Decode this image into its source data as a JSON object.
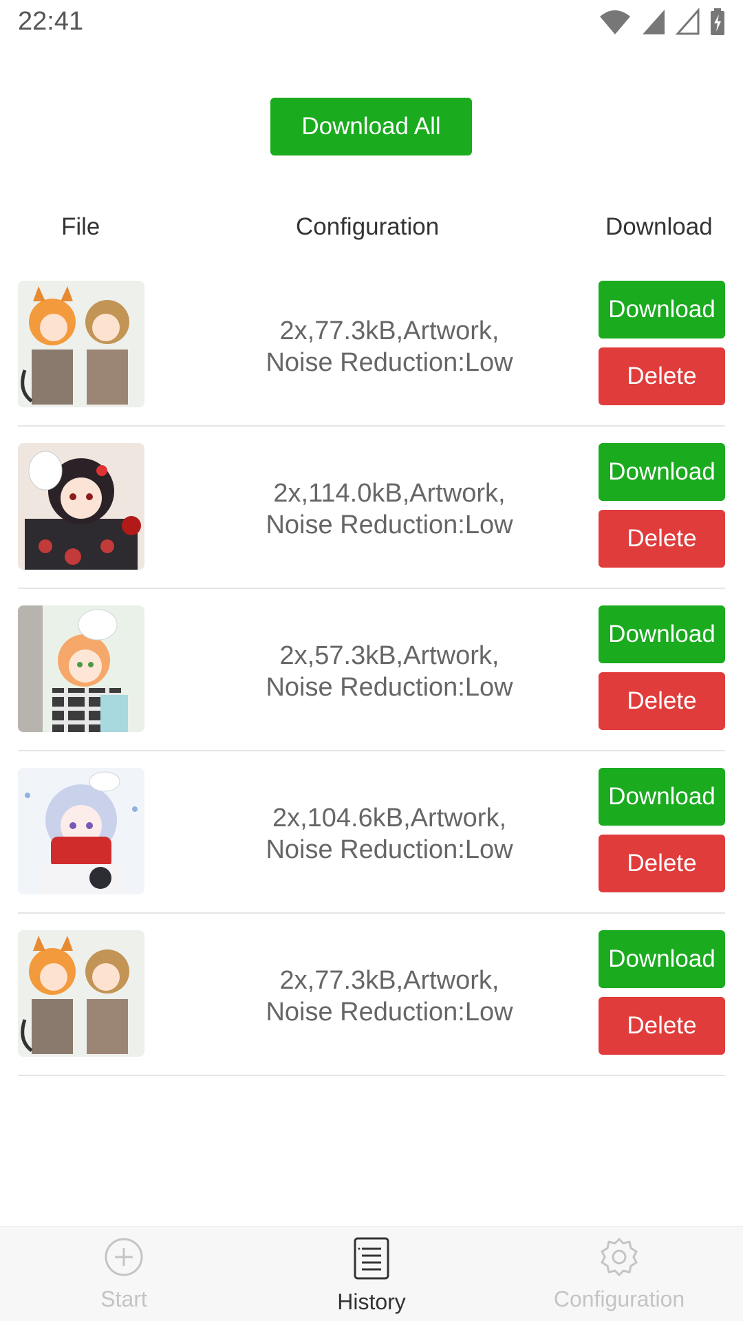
{
  "status_bar": {
    "time": "22:41"
  },
  "header": {
    "download_all_label": "Download All"
  },
  "table": {
    "columns": [
      "File",
      "Configuration",
      "Download"
    ],
    "rows": [
      {
        "thumb": "anime-cat-girls",
        "config_line1": "2x,77.3kB,Artwork,",
        "config_line2": "Noise Reduction:Low",
        "download_label": "Download",
        "delete_label": "Delete"
      },
      {
        "thumb": "anime-kimono-girl",
        "config_line1": "2x,114.0kB,Artwork,",
        "config_line2": "Noise Reduction:Low",
        "download_label": "Download",
        "delete_label": "Delete"
      },
      {
        "thumb": "anime-mask-girl",
        "config_line1": "2x,57.3kB,Artwork,",
        "config_line2": "Noise Reduction:Low",
        "download_label": "Download",
        "delete_label": "Delete"
      },
      {
        "thumb": "anime-scarf-girl",
        "config_line1": "2x,104.6kB,Artwork,",
        "config_line2": "Noise Reduction:Low",
        "download_label": "Download",
        "delete_label": "Delete"
      },
      {
        "thumb": "anime-cat-girls",
        "config_line1": "2x,77.3kB,Artwork,",
        "config_line2": "Noise Reduction:Low",
        "download_label": "Download",
        "delete_label": "Delete"
      }
    ]
  },
  "tabbar": {
    "tabs": [
      {
        "label": "Start",
        "icon": "plus-circle-icon",
        "active": false
      },
      {
        "label": "History",
        "icon": "list-document-icon",
        "active": true
      },
      {
        "label": "Configuration",
        "icon": "gear-icon",
        "active": false
      }
    ]
  },
  "colors": {
    "green": "#1aab1f",
    "red": "#e03c3c"
  }
}
